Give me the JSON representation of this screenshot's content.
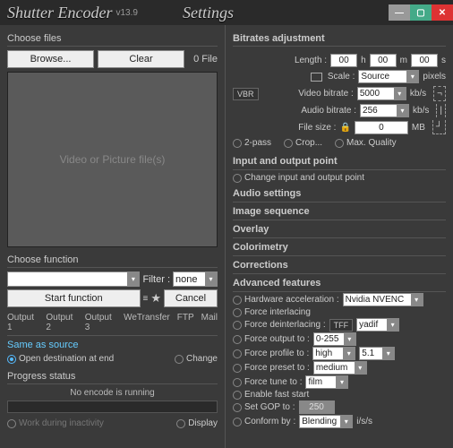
{
  "title": {
    "main": "Shutter Encoder",
    "version": "v13.9",
    "settings": "Settings"
  },
  "left": {
    "choose_files": "Choose files",
    "browse": "Browse...",
    "clear": "Clear",
    "file_count": "0 File",
    "placeholder": "Video or Picture file(s)",
    "choose_function": "Choose function",
    "filter_lbl": "Filter :",
    "filter_val": "none",
    "start": "Start function",
    "menu_icon": "≡",
    "star_icon": "★",
    "cancel": "Cancel",
    "tabs": [
      "Output 1",
      "Output 2",
      "Output 3",
      "WeTransfer",
      "FTP",
      "Mail"
    ],
    "same_source": "Same as source",
    "open_dest": "Open destination at end",
    "change": "Change",
    "progress": "Progress status",
    "no_encode": "No encode is running",
    "work_inactivity": "Work during inactivity",
    "display": "Display"
  },
  "right": {
    "bitrates": "Bitrates adjustment",
    "length": "Length :",
    "h": "00",
    "hh": "h",
    "m": "00",
    "mm": "m",
    "s": "00",
    "ss": "s",
    "scale": "Scale :",
    "scale_val": "Source",
    "pixels": "pixels",
    "vbr": "VBR",
    "vbitrate": "Video bitrate :",
    "vbitrate_val": "5000",
    "kbs": "kb/s",
    "abitrate": "Audio bitrate :",
    "abitrate_val": "256",
    "filesize": "File size :",
    "filesize_val": "0",
    "mb": "MB",
    "lock": "🔒",
    "twopass": "2-pass",
    "crop": "Crop...",
    "maxq": "Max. Quality",
    "io": "Input and output point",
    "io_change": "Change input and output point",
    "audio": "Audio settings",
    "imgseq": "Image sequence",
    "overlay": "Overlay",
    "colorimetry": "Colorimetry",
    "corrections": "Corrections",
    "adv": "Advanced features",
    "hwaccel": "Hardware acceleration :",
    "hwaccel_val": "Nvidia NVENC",
    "fint": "Force interlacing",
    "fdeint": "Force deinterlacing :",
    "tff": "TFF",
    "yadif": "yadif",
    "fout": "Force output to :",
    "fout_val": "0-255",
    "fprof": "Force profile to :",
    "fprof_val": "high",
    "fprof2": "5.1",
    "fpreset": "Force preset to :",
    "fpreset_val": "medium",
    "ftune": "Force tune to :",
    "ftune_val": "film",
    "efs": "Enable fast start",
    "sgop": "Set GOP to :",
    "sgop_val": "250",
    "conform": "Conform by :",
    "conform_val": "Blending",
    "iss": "i/s/s"
  }
}
